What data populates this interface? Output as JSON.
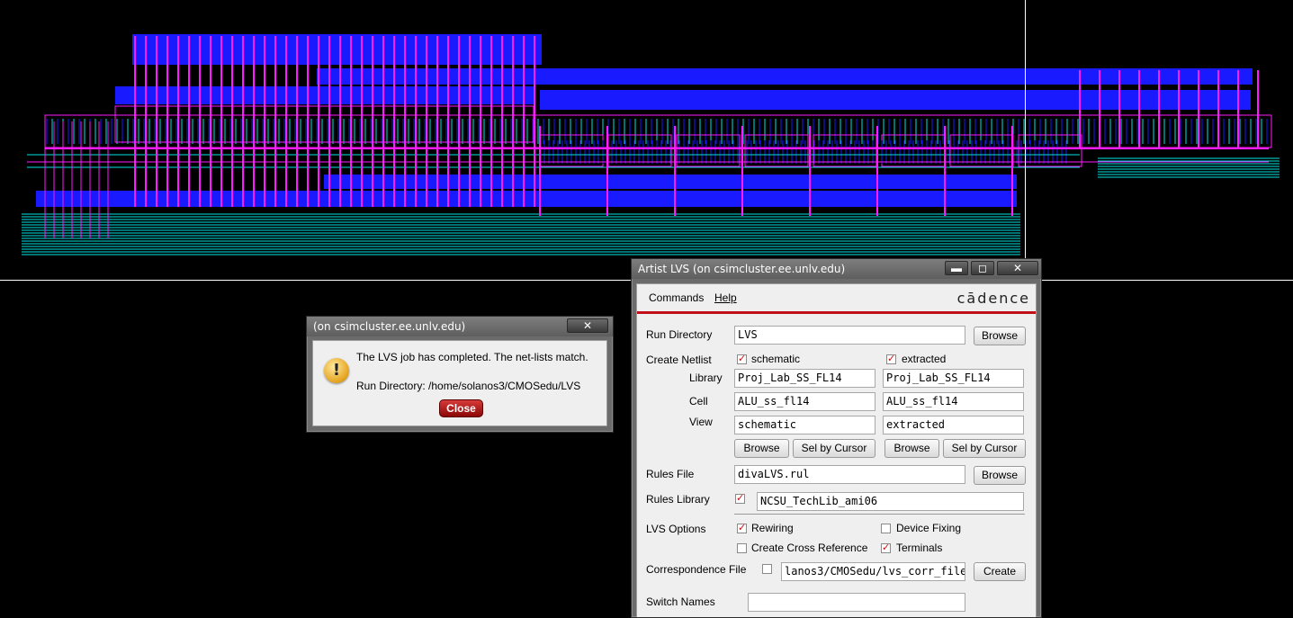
{
  "colors": {
    "background": "#000000",
    "metal1": "#1a1aff",
    "metal2": "#ff1aff",
    "poly": "#00e5e5",
    "dialog_close": "#b01010",
    "brand_red": "#c0101a"
  },
  "message_dialog": {
    "title": "(on csimcluster.ee.unlv.edu)",
    "close_glyph": "✕",
    "icon": "warning-icon",
    "line1": "The LVS job has completed. The net-lists match.",
    "line2": "Run Directory: /home/solanos3/CMOSedu/LVS",
    "close_button": "Close"
  },
  "lvs_window": {
    "title": "Artist LVS (on csimcluster.ee.unlv.edu)",
    "window_controls": {
      "minimize": "▬",
      "maximize": "◻",
      "close": "✕"
    },
    "menu": {
      "commands": "Commands",
      "help": "Help"
    },
    "brand": "cādence",
    "run_directory": {
      "label": "Run Directory",
      "value": "LVS",
      "browse": "Browse"
    },
    "create_netlist": {
      "label": "Create Netlist",
      "schematic": {
        "label": "schematic",
        "checked": true
      },
      "extracted": {
        "label": "extracted",
        "checked": true
      },
      "library_label": "Library",
      "cell_label": "Cell",
      "view_label": "View",
      "schematic_library": "Proj_Lab_SS_FL14",
      "schematic_cell": "ALU_ss_fl14",
      "schematic_view": "schematic",
      "extracted_library": "Proj_Lab_SS_FL14",
      "extracted_cell": "ALU_ss_fl14",
      "extracted_view": "extracted",
      "browse": "Browse",
      "sel_by_cursor": "Sel by Cursor"
    },
    "rules_file": {
      "label": "Rules File",
      "value": "divaLVS.rul",
      "browse": "Browse"
    },
    "rules_library": {
      "label": "Rules Library",
      "checked": true,
      "value": "NCSU_TechLib_ami06"
    },
    "lvs_options": {
      "label": "LVS Options",
      "rewiring": {
        "label": "Rewiring",
        "checked": true
      },
      "device_fixing": {
        "label": "Device Fixing",
        "checked": false
      },
      "create_cross_reference": {
        "label": "Create Cross Reference",
        "checked": false
      },
      "terminals": {
        "label": "Terminals",
        "checked": true
      }
    },
    "correspondence_file": {
      "label": "Correspondence File",
      "checked": false,
      "value": "lanos3/CMOSedu/lvs_corr_file",
      "create": "Create"
    },
    "switch_names": {
      "label": "Switch Names",
      "value": ""
    }
  }
}
